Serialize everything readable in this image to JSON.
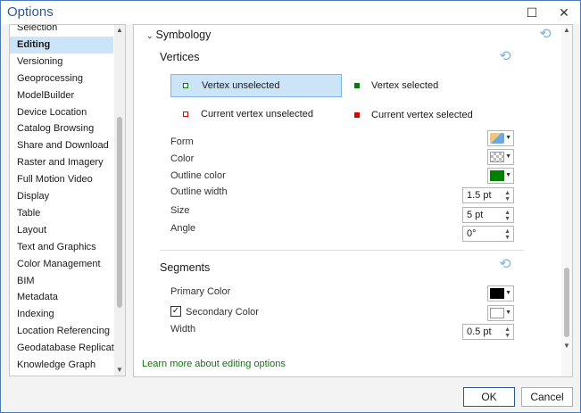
{
  "window": {
    "title": "Options",
    "minimize": "—",
    "maximize": "☐",
    "close": "✕"
  },
  "nav": {
    "items": [
      {
        "label": "Selection"
      },
      {
        "label": "Editing",
        "active": true
      },
      {
        "label": "Versioning"
      },
      {
        "label": "Geoprocessing"
      },
      {
        "label": "ModelBuilder"
      },
      {
        "label": "Device Location"
      },
      {
        "label": "Catalog Browsing"
      },
      {
        "label": "Share and Download"
      },
      {
        "label": "Raster and Imagery"
      },
      {
        "label": "Full Motion Video"
      },
      {
        "label": "Display"
      },
      {
        "label": "Table"
      },
      {
        "label": "Layout"
      },
      {
        "label": "Text and Graphics"
      },
      {
        "label": "Color Management"
      },
      {
        "label": "BIM"
      },
      {
        "label": "Metadata"
      },
      {
        "label": "Indexing"
      },
      {
        "label": "Location Referencing"
      },
      {
        "label": "Geodatabase Replication"
      },
      {
        "label": "Knowledge Graph"
      }
    ]
  },
  "symbology": {
    "header": "Symbology",
    "vertices": {
      "title": "Vertices",
      "options": {
        "vertex_unselected": "Vertex unselected",
        "vertex_selected": "Vertex selected",
        "current_unselected": "Current vertex unselected",
        "current_selected": "Current vertex selected"
      },
      "colors": {
        "green": "#008000",
        "red": "#e00000"
      },
      "properties": {
        "form": "Form",
        "color": "Color",
        "outline_color": "Outline color",
        "outline_width": "Outline width",
        "size": "Size",
        "angle": "Angle"
      },
      "values": {
        "outline_width": "1.5 pt",
        "size": "5 pt",
        "angle": "0°"
      }
    },
    "segments": {
      "title": "Segments",
      "primary_color": "Primary Color",
      "secondary_color": "Secondary Color",
      "width": "Width",
      "width_value": "0.5 pt",
      "secondary_enabled": true,
      "primary_swatch": "#000000",
      "secondary_swatch": "#ffffff"
    },
    "learn_more": "Learn more about editing options"
  },
  "footer": {
    "ok": "OK",
    "cancel": "Cancel"
  }
}
